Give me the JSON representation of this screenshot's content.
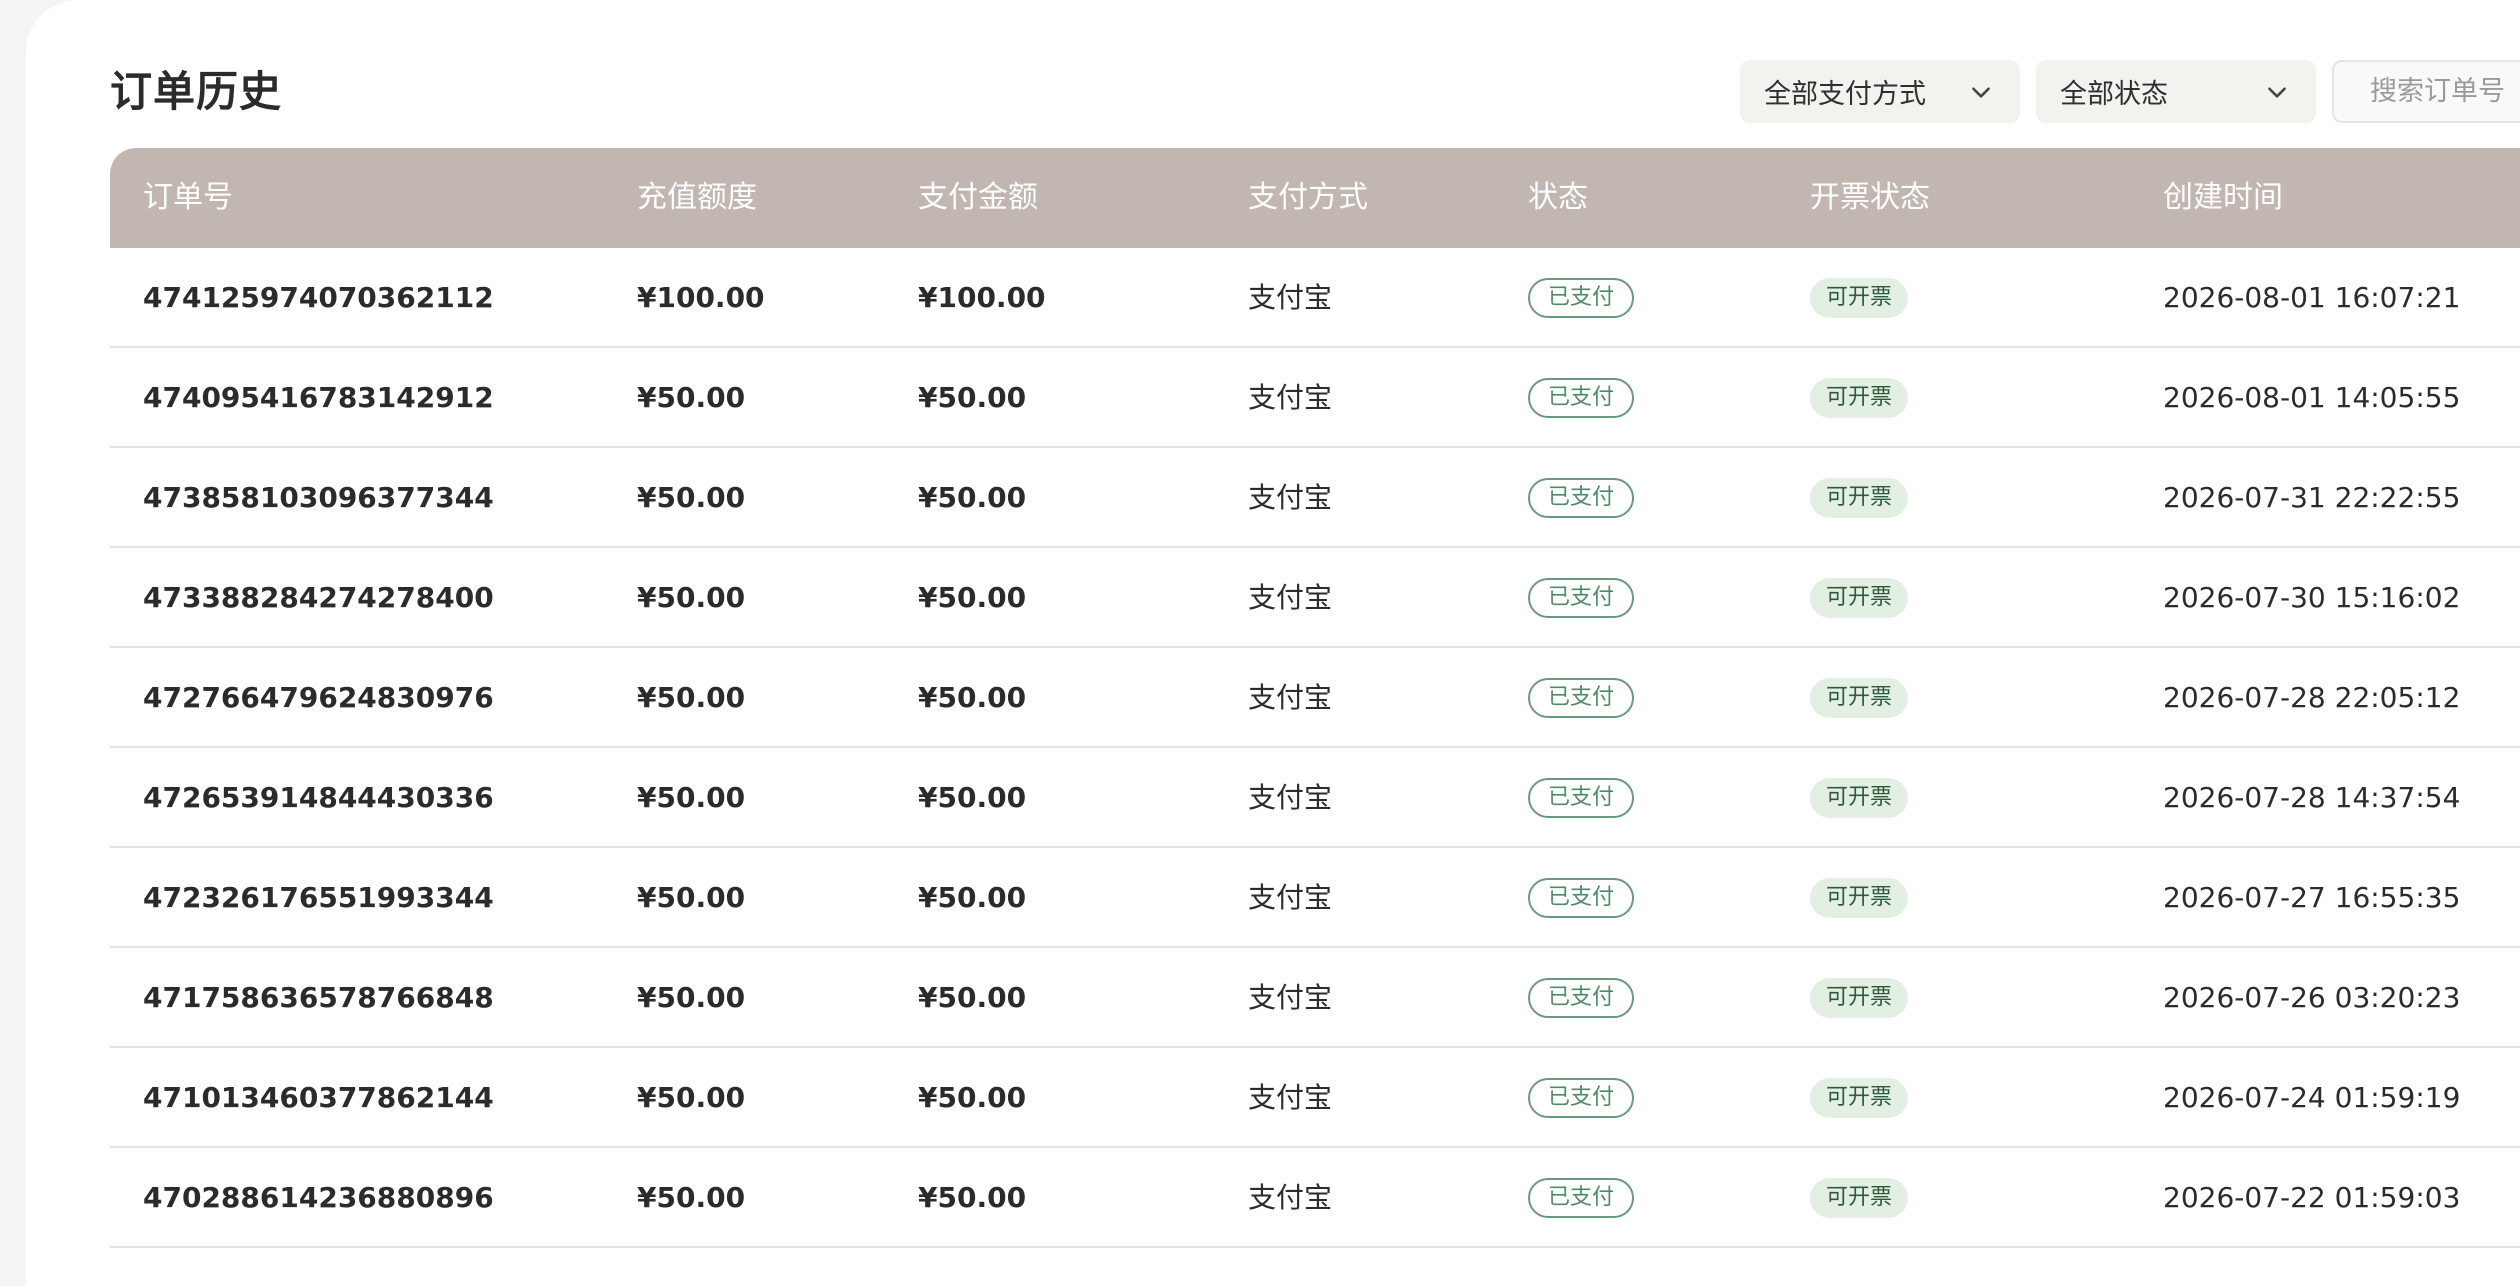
{
  "page": {
    "title": "订单历史"
  },
  "filters": {
    "payment_method": "全部支付方式",
    "status": "全部状态",
    "search_placeholder": "搜索订单号"
  },
  "table": {
    "columns": [
      "订单号",
      "充值额度",
      "支付金额",
      "支付方式",
      "状态",
      "开票状态",
      "创建时间"
    ],
    "rows": [
      {
        "order_id": "474125974070362112",
        "recharge": "¥100.00",
        "amount": "¥100.00",
        "method": "支付宝",
        "status": "已支付",
        "invoice": "可开票",
        "created": "2026-08-01 16:07:21"
      },
      {
        "order_id": "474095416783142912",
        "recharge": "¥50.00",
        "amount": "¥50.00",
        "method": "支付宝",
        "status": "已支付",
        "invoice": "可开票",
        "created": "2026-08-01 14:05:55"
      },
      {
        "order_id": "473858103096377344",
        "recharge": "¥50.00",
        "amount": "¥50.00",
        "method": "支付宝",
        "status": "已支付",
        "invoice": "可开票",
        "created": "2026-07-31 22:22:55"
      },
      {
        "order_id": "473388284274278400",
        "recharge": "¥50.00",
        "amount": "¥50.00",
        "method": "支付宝",
        "status": "已支付",
        "invoice": "可开票",
        "created": "2026-07-30 15:16:02"
      },
      {
        "order_id": "472766479624830976",
        "recharge": "¥50.00",
        "amount": "¥50.00",
        "method": "支付宝",
        "status": "已支付",
        "invoice": "可开票",
        "created": "2026-07-28 22:05:12"
      },
      {
        "order_id": "472653914844430336",
        "recharge": "¥50.00",
        "amount": "¥50.00",
        "method": "支付宝",
        "status": "已支付",
        "invoice": "可开票",
        "created": "2026-07-28 14:37:54"
      },
      {
        "order_id": "472326176551993344",
        "recharge": "¥50.00",
        "amount": "¥50.00",
        "method": "支付宝",
        "status": "已支付",
        "invoice": "可开票",
        "created": "2026-07-27 16:55:35"
      },
      {
        "order_id": "471758636578766848",
        "recharge": "¥50.00",
        "amount": "¥50.00",
        "method": "支付宝",
        "status": "已支付",
        "invoice": "可开票",
        "created": "2026-07-26 03:20:23"
      },
      {
        "order_id": "471013460377862144",
        "recharge": "¥50.00",
        "amount": "¥50.00",
        "method": "支付宝",
        "status": "已支付",
        "invoice": "可开票",
        "created": "2026-07-24 01:59:19"
      },
      {
        "order_id": "470288614236880896",
        "recharge": "¥50.00",
        "amount": "¥50.00",
        "method": "支付宝",
        "status": "已支付",
        "invoice": "可开票",
        "created": "2026-07-22 01:59:03"
      }
    ]
  },
  "icons": {
    "dropdown": "chevron-down-icon",
    "search": "search-icon"
  },
  "colors": {
    "header_bg": "#c2b6b0",
    "paid_badge": "#4f8a66",
    "invoice_badge_bg": "#e3efe3"
  }
}
